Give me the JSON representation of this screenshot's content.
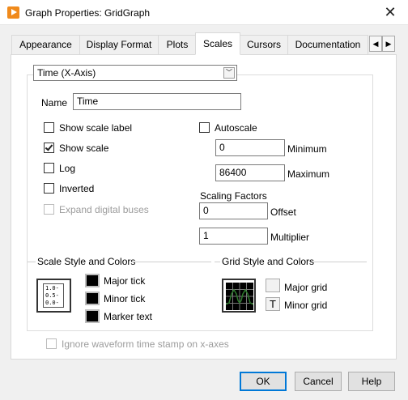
{
  "window": {
    "title": "Graph Properties: GridGraph",
    "close_glyph": "✕"
  },
  "tabs": [
    {
      "label": "Appearance",
      "active": false
    },
    {
      "label": "Display Format",
      "active": false
    },
    {
      "label": "Plots",
      "active": false
    },
    {
      "label": "Scales",
      "active": true
    },
    {
      "label": "Cursors",
      "active": false
    },
    {
      "label": "Documentation",
      "active": false
    }
  ],
  "tab_scroll": {
    "left_glyph": "◀",
    "right_glyph": "▶"
  },
  "axis_select": {
    "value": "Time (X-Axis)",
    "arrow_glyph": "﹀"
  },
  "name_field": {
    "label": "Name",
    "value": "Time"
  },
  "options": {
    "show_scale_label": {
      "label": "Show scale label",
      "checked": false
    },
    "show_scale": {
      "label": "Show scale",
      "checked": true
    },
    "log": {
      "label": "Log",
      "checked": false
    },
    "inverted": {
      "label": "Inverted",
      "checked": false
    },
    "expand_digital_buses": {
      "label": "Expand digital buses",
      "checked": false,
      "disabled": true
    },
    "autoscale": {
      "label": "Autoscale",
      "checked": false
    }
  },
  "range": {
    "minimum_value": "0",
    "minimum_label": "Minimum",
    "maximum_value": "86400",
    "maximum_label": "Maximum"
  },
  "scaling_factors": {
    "title": "Scaling Factors",
    "offset_value": "0",
    "offset_label": "Offset",
    "multiplier_value": "1",
    "multiplier_label": "Multiplier"
  },
  "scale_style": {
    "title": "Scale Style and Colors",
    "icon_lines": [
      "1.0-",
      "0.5-",
      "0.0-"
    ],
    "major_tick_label": "Major tick",
    "minor_tick_label": "Minor tick",
    "marker_text_label": "Marker text",
    "swatch_color": "#000000"
  },
  "grid_style": {
    "title": "Grid Style and Colors",
    "major_grid_label": "Major grid",
    "minor_grid_label": "Minor grid",
    "plot_color": "#2d7a2d"
  },
  "ignore_timestamp": {
    "label": "Ignore waveform time stamp on x-axes",
    "checked": false,
    "disabled": true
  },
  "buttons": {
    "ok": "OK",
    "cancel": "Cancel",
    "help": "Help"
  }
}
